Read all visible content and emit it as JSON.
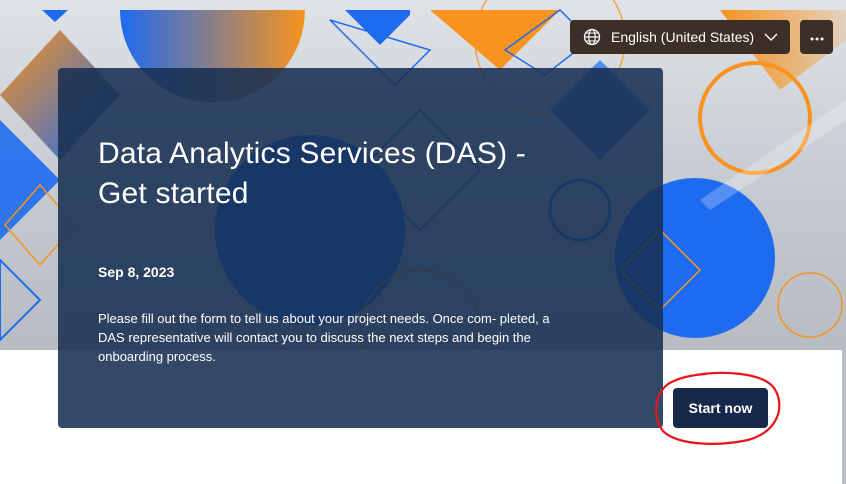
{
  "header": {
    "language_label": "English (United States)",
    "more_label": "⋯"
  },
  "form": {
    "title": "Data Analytics Services (DAS) - Get started",
    "date": "Sep 8, 2023",
    "description": "Please fill out the form to tell us about your project needs. Once com- pleted, a DAS representative will contact you to discuss the next steps and begin the onboarding process."
  },
  "actions": {
    "start_label": "Start now"
  },
  "colors": {
    "orange": "#f7931e",
    "blue": "#1f6bf0",
    "navy": "#17294a"
  }
}
